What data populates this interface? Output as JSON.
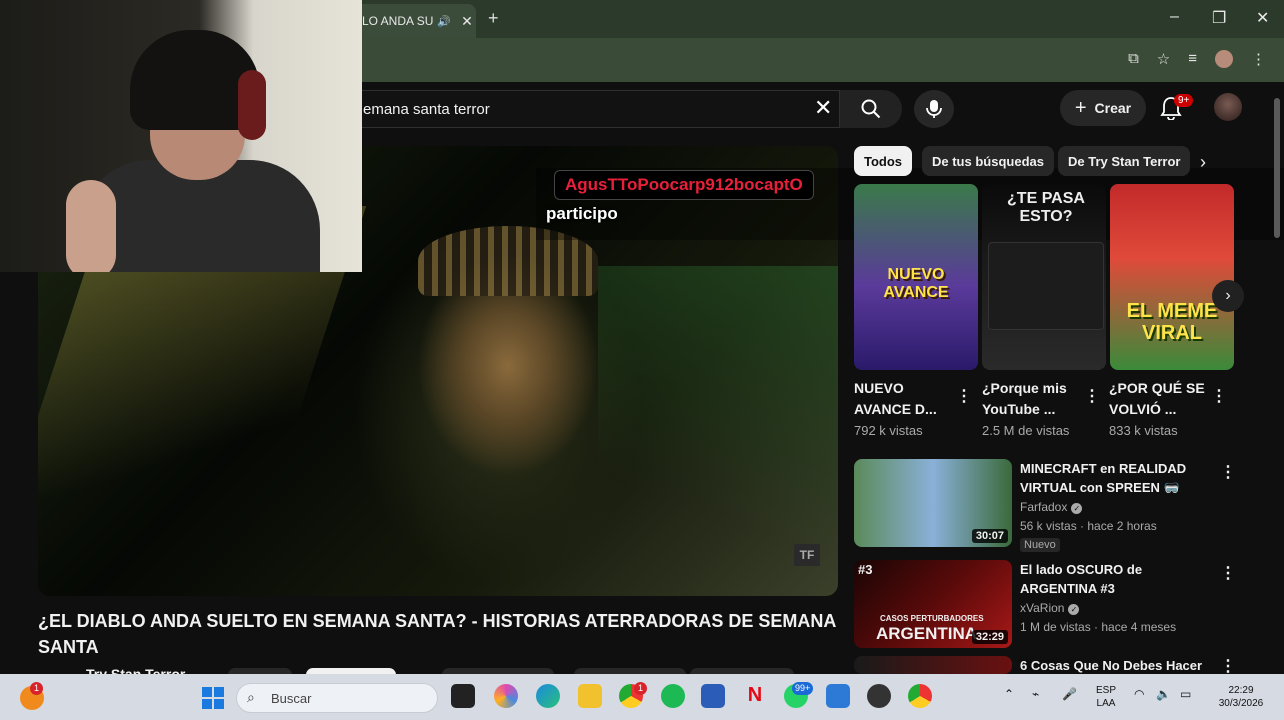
{
  "browser": {
    "tab_title": "LO ANDA SU",
    "tab_close": "✕",
    "new_tab": "+",
    "minimize": "–",
    "maximize": "❐",
    "close": "✕"
  },
  "youtube": {
    "search_query": "emana santa terror",
    "create_label": "Crear",
    "notif_count": "9+"
  },
  "stream_overlay": {
    "chat_user": "AgusTToPoocarp912bocaptO",
    "chat_message": "participo"
  },
  "video": {
    "title": "¿EL DIABLO ANDA SUELTO EN SEMANA SANTA? - HISTORIAS ATERRADORAS DE SEMANA SANTA",
    "channel": "Try Stan Terror",
    "watermark": "TF"
  },
  "chips": [
    {
      "label": "Todos"
    },
    {
      "label": "De tus búsquedas"
    },
    {
      "label": "De Try Stan Terror"
    }
  ],
  "shorts": [
    {
      "title": "NUEVO AVANCE D...",
      "views": "792 k vistas",
      "thumb_text": "NUEVO AVANCE"
    },
    {
      "title": "¿Porque mis YouTube ...",
      "views": "2.5 M de vistas",
      "thumb_text": "¿TE PASA ESTO?"
    },
    {
      "title": "¿POR QUÉ SE VOLVIÓ ...",
      "views": "833 k vistas",
      "thumb_text": "EL MEME VIRAL"
    }
  ],
  "suggestions": [
    {
      "title": "MINECRAFT en REALIDAD VIRTUAL con SPREEN 🥽",
      "channel": "Farfadox",
      "meta": "56 k vistas · hace 2 horas",
      "badge": "Nuevo",
      "duration": "30:07"
    },
    {
      "title": "El lado OSCURO de ARGENTINA #3",
      "channel": "xVaRion",
      "meta": "1 M de vistas · hace 4 meses",
      "duration": "32:29",
      "thumb_text": "ARGENTINA",
      "thumb_tag": "#3",
      "thumb_sub": "CASOS PERTURBADORES"
    },
    {
      "title": "6 Cosas Que No Debes Hacer"
    }
  ],
  "taskbar": {
    "search_placeholder": "Buscar",
    "lang_1": "ESP",
    "lang_2": "LAA",
    "time": "22:29",
    "date": "30/3/2026",
    "chrome_badge": "1",
    "whatsapp_badge": "99+",
    "left_badge": "1"
  },
  "colors": {
    "yt_bg": "#0f0f0f",
    "accent_red": "#cc0000",
    "chip_active": "#f1f1f1",
    "browser_chrome": "#3a4b38"
  }
}
